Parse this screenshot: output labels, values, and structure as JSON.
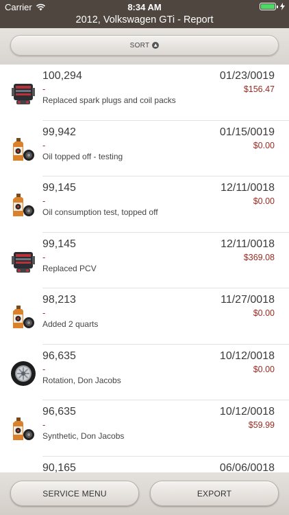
{
  "status": {
    "carrier": "Carrier",
    "time": "8:34 AM"
  },
  "nav": {
    "title": "2012, Volkswagen GTi - Report"
  },
  "sort": {
    "label": "SORT"
  },
  "entries": [
    {
      "odometer": "100,294",
      "dash": "-",
      "note": "Replaced spark plugs and coil packs",
      "date": "01/23/0019",
      "cost": "$156.47",
      "icon": "engine-icon"
    },
    {
      "odometer": "99,942",
      "dash": "-",
      "note": "Oil topped off - testing",
      "date": "01/15/0019",
      "cost": "$0.00",
      "icon": "oil-bottle-icon"
    },
    {
      "odometer": "99,145",
      "dash": "-",
      "note": "Oil consumption test, topped off",
      "date": "12/11/0018",
      "cost": "$0.00",
      "icon": "oil-bottle-icon"
    },
    {
      "odometer": "99,145",
      "dash": "-",
      "note": "Replaced PCV",
      "date": "12/11/0018",
      "cost": "$369.08",
      "icon": "engine-icon"
    },
    {
      "odometer": "98,213",
      "dash": "-",
      "note": "Added 2 quarts",
      "date": "11/27/0018",
      "cost": "$0.00",
      "icon": "oil-bottle-icon"
    },
    {
      "odometer": "96,635",
      "dash": "-",
      "note": "Rotation, Don Jacobs",
      "date": "10/12/0018",
      "cost": "$0.00",
      "icon": "tire-icon"
    },
    {
      "odometer": "96,635",
      "dash": "-",
      "note": "Synthetic, Don Jacobs",
      "date": "10/12/0018",
      "cost": "$59.99",
      "icon": "oil-bottle-icon"
    },
    {
      "odometer": "90,165",
      "dash": "-",
      "note": "",
      "date": "06/06/0018",
      "cost": "",
      "icon": ""
    }
  ],
  "toolbar": {
    "service_menu": "SERVICE MENU",
    "export": "EXPORT"
  }
}
